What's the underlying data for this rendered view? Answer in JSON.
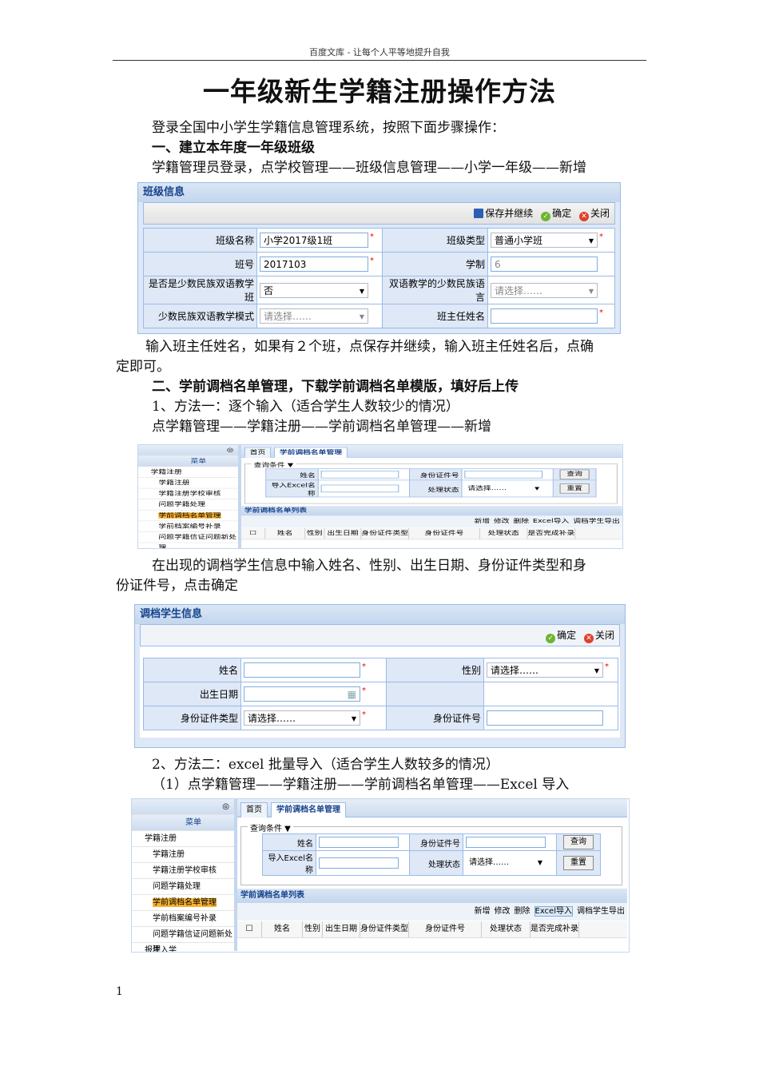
{
  "header": "百度文库 - 让每个人平等地提升自我",
  "title": "一年级新生学籍注册操作方法",
  "paras": {
    "p1": "登录全国中小学生学籍信息管理系统，按照下面步骤操作：",
    "h1": "一、建立本年度一年级班级",
    "p2": "学籍管理员登录，点学校管理——班级信息管理——小学一年级——新增",
    "p3a": "输入班主任姓名，如果有２个班，点保存并继续，输入班主任姓名后，点确",
    "p3b": "定即可。",
    "h2": "二、学前调档名单管理，下载学前调档名单模版，填好后上传",
    "p4": "1、方法一：逐个输入（适合学生人数较少的情况）",
    "p5": "点学籍管理——学籍注册——学前调档名单管理——新增",
    "p6a": "在出现的调档学生信息中输入姓名、性别、出生日期、身份证件类型和身",
    "p6b": "份证件号，点击确定",
    "p7": "2、方法二：excel 批量导入（适合学生人数较多的情况）",
    "p8": "（1）点学籍管理——学籍注册——学前调档名单管理——Excel 导入"
  },
  "page_number": "1",
  "class_form": {
    "title": "班级信息",
    "save_continue": "保存并继续",
    "ok": "确定",
    "close": "关闭",
    "class_name_label": "班级名称",
    "class_name": "小学2017级1班",
    "class_type_label": "班级类型",
    "class_type": "普通小学班",
    "class_no_label": "班号",
    "class_no": "2017103",
    "years_label": "学制",
    "years": "6",
    "bilingual_label": "是否是少数民族双语教学班",
    "bilingual": "否",
    "lang_label": "双语教学的少数民族语言",
    "lang": "请选择……",
    "mode_label": "少数民族双语教学模式",
    "mode": "请选择……",
    "teacher_label": "班主任姓名"
  },
  "student_form": {
    "title": "调档学生信息",
    "ok": "确定",
    "close": "关闭",
    "name_label": "姓名",
    "gender_label": "性别",
    "gender": "请选择……",
    "birth_label": "出生日期",
    "idtype_label": "身份证件类型",
    "idtype": "请选择……",
    "id_label": "身份证件号"
  },
  "admin": {
    "menu": "菜单",
    "sidebar": [
      "学籍注册",
      "学籍注册",
      "学籍注册学校审核",
      "问题学籍处理",
      "学前调档名单管理",
      "学前档案编号补录",
      "问题学籍信证问题新处理",
      "报生入学"
    ],
    "tabs": [
      "首页",
      "学前调档名单管理"
    ],
    "query_label": "查询条件 ▼",
    "name_label": "姓名",
    "id_label": "身份证件号",
    "excel_label": "导入Excel名称",
    "status_label": "处理状态",
    "status": "请选择……",
    "search": "查询",
    "reset": "重置",
    "list_title": "学前调档名单列表",
    "actions": [
      "新增",
      "修改",
      "删除",
      "Excel导入",
      "调档学生导出"
    ],
    "columns": [
      "姓名",
      "性别",
      "出生日期",
      "身份证件类型",
      "身份证件号",
      "处理状态",
      "是否完成补录"
    ]
  }
}
